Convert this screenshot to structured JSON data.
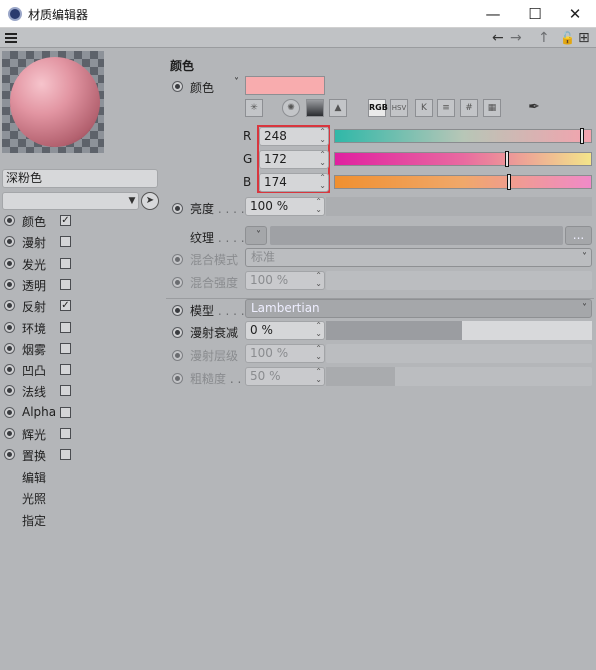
{
  "window": {
    "title": "材质编辑器",
    "minimize": "—",
    "maximize": "☐",
    "close": "✕"
  },
  "toolbar": {
    "menu_icon": "hamburger-icon",
    "back": "←",
    "forward": "→",
    "up": "↑",
    "lock": "🔓",
    "new": "⊞"
  },
  "material": {
    "name": "深粉色",
    "preview_color": "#e8a0ac"
  },
  "channels": [
    {
      "label": "颜色",
      "checked": true
    },
    {
      "label": "漫射",
      "checked": false
    },
    {
      "label": "发光",
      "checked": false
    },
    {
      "label": "透明",
      "checked": false
    },
    {
      "label": "反射",
      "checked": true
    },
    {
      "label": "环境",
      "checked": false
    },
    {
      "label": "烟雾",
      "checked": false
    },
    {
      "label": "凹凸",
      "checked": false
    },
    {
      "label": "法线",
      "checked": false
    },
    {
      "label": "Alpha",
      "checked": false
    },
    {
      "label": "辉光",
      "checked": false
    },
    {
      "label": "置换",
      "checked": false
    }
  ],
  "extra_items": [
    "编辑",
    "光照",
    "指定"
  ],
  "color_panel": {
    "section_title": "颜色",
    "color_label": "颜色",
    "color_hex": "#f8acae",
    "mode_buttons": {
      "rgb": "RGB",
      "hsv": "HSV",
      "k": "K",
      "eq": "≡",
      "hash": "#"
    },
    "rgb": [
      {
        "letter": "R",
        "value": "248",
        "fraction": 0.973
      },
      {
        "letter": "G",
        "value": "172",
        "fraction": 0.675
      },
      {
        "letter": "B",
        "value": "174",
        "fraction": 0.682
      }
    ],
    "brightness_label": "亮度",
    "brightness_value": "100 %",
    "texture_label": "纹理",
    "texture_browse": "...",
    "blend_mode_label": "混合模式",
    "blend_mode_value": "标准",
    "blend_strength_label": "混合强度",
    "blend_strength_value": "100 %"
  },
  "shading": {
    "model_label": "模型",
    "model_value": "Lambertian",
    "diffuse_falloff_label": "漫射衰减",
    "diffuse_falloff_value": "0 %",
    "diffuse_level_label": "漫射层级",
    "diffuse_level_value": "100 %",
    "roughness_label": "粗糙度",
    "roughness_value": "50 %"
  }
}
